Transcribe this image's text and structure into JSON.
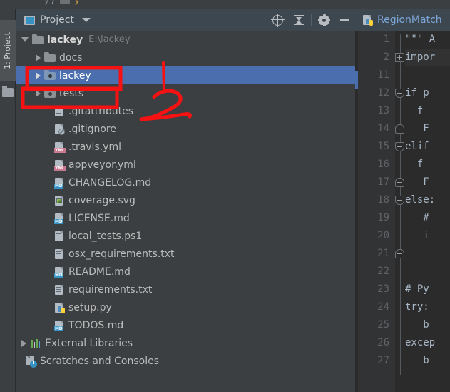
{
  "window": {
    "breadcrumb_partial": "y / ▭ — y",
    "tool_tab_label": "1: Project"
  },
  "panel": {
    "title": "Project",
    "window_icon": "project-window-icon",
    "dropdown_icon": "chevron-down-icon",
    "actions": [
      {
        "name": "locate-in-tree",
        "icon": "target-icon"
      },
      {
        "name": "collapse-all",
        "icon": "collapse-all-icon"
      },
      {
        "name": "settings",
        "icon": "gear-icon"
      },
      {
        "name": "hide-panel",
        "icon": "minimize-icon"
      }
    ]
  },
  "tree": {
    "rows": [
      {
        "label": "lackey",
        "path": "E:\\lackey",
        "indent": 0,
        "arrow": "open",
        "icon": "folder-icon",
        "bold": true,
        "selected": false
      },
      {
        "label": "docs",
        "path": "",
        "indent": 1,
        "arrow": "closed",
        "icon": "folder-icon",
        "bold": false,
        "selected": false
      },
      {
        "label": "lackey",
        "path": "",
        "indent": 1,
        "arrow": "closed",
        "icon": "source-folder-icon",
        "bold": false,
        "selected": true
      },
      {
        "label": "tests",
        "path": "",
        "indent": 1,
        "arrow": "closed",
        "icon": "test-folder-icon",
        "bold": false,
        "selected": false
      },
      {
        "label": ".gitattributes",
        "path": "",
        "indent": 2,
        "arrow": "none",
        "icon": "text-file-icon",
        "bold": false,
        "selected": false
      },
      {
        "label": ".gitignore",
        "path": "",
        "indent": 2,
        "arrow": "none",
        "icon": "ignore-file-icon",
        "bold": false,
        "selected": false
      },
      {
        "label": ".travis.yml",
        "path": "",
        "indent": 2,
        "arrow": "none",
        "icon": "yml-file-icon",
        "bold": false,
        "selected": false
      },
      {
        "label": "appveyor.yml",
        "path": "",
        "indent": 2,
        "arrow": "none",
        "icon": "yml-file-icon",
        "bold": false,
        "selected": false
      },
      {
        "label": "CHANGELOG.md",
        "path": "",
        "indent": 2,
        "arrow": "none",
        "icon": "md-file-icon",
        "bold": false,
        "selected": false
      },
      {
        "label": "coverage.svg",
        "path": "",
        "indent": 2,
        "arrow": "none",
        "icon": "svg-file-icon",
        "bold": false,
        "selected": false
      },
      {
        "label": "LICENSE.md",
        "path": "",
        "indent": 2,
        "arrow": "none",
        "icon": "md-file-icon",
        "bold": false,
        "selected": false
      },
      {
        "label": "local_tests.ps1",
        "path": "",
        "indent": 2,
        "arrow": "none",
        "icon": "text-file-icon",
        "bold": false,
        "selected": false
      },
      {
        "label": "osx_requirements.txt",
        "path": "",
        "indent": 2,
        "arrow": "none",
        "icon": "text-file-icon",
        "bold": false,
        "selected": false
      },
      {
        "label": "README.md",
        "path": "",
        "indent": 2,
        "arrow": "none",
        "icon": "md-file-icon",
        "bold": false,
        "selected": false
      },
      {
        "label": "requirements.txt",
        "path": "",
        "indent": 2,
        "arrow": "none",
        "icon": "text-file-icon",
        "bold": false,
        "selected": false
      },
      {
        "label": "setup.py",
        "path": "",
        "indent": 2,
        "arrow": "none",
        "icon": "python-file-icon",
        "bold": false,
        "selected": false
      },
      {
        "label": "TODOS.md",
        "path": "",
        "indent": 2,
        "arrow": "none",
        "icon": "md-file-icon",
        "bold": false,
        "selected": false
      },
      {
        "label": "External Libraries",
        "path": "",
        "indent": 0,
        "arrow": "closed",
        "icon": "libraries-icon",
        "bold": false,
        "selected": false
      },
      {
        "label": "Scratches and Consoles",
        "path": "",
        "indent": 0,
        "arrow": "none",
        "icon": "scratches-icon",
        "bold": false,
        "selected": false
      }
    ]
  },
  "editor": {
    "tab_label": "RegionMatch",
    "tab_icon": "python-file-icon",
    "lines": [
      {
        "num": "1",
        "fold": "none",
        "text": "\"\"\" A",
        "cls": "c-str"
      },
      {
        "num": "2",
        "fold": "plus",
        "text": "impor",
        "cls": "c-ident"
      },
      {
        "num": "11",
        "fold": "none",
        "text": "",
        "cls": "c-ident"
      },
      {
        "num": "12",
        "fold": "down",
        "text": "if p",
        "cls": "c-kw"
      },
      {
        "num": "13",
        "fold": "none",
        "text": "  f",
        "cls": "c-kw"
      },
      {
        "num": "14",
        "fold": "up",
        "text": "   F",
        "cls": "c-ident"
      },
      {
        "num": "15",
        "fold": "down",
        "text": "elif",
        "cls": "c-kw"
      },
      {
        "num": "16",
        "fold": "none",
        "text": "  f",
        "cls": "c-kw"
      },
      {
        "num": "17",
        "fold": "up",
        "text": "   F",
        "cls": "c-ident"
      },
      {
        "num": "18",
        "fold": "down",
        "text": "else:",
        "cls": "c-kw"
      },
      {
        "num": "19",
        "fold": "none",
        "text": "   #",
        "cls": "c-cmt"
      },
      {
        "num": "20",
        "fold": "none",
        "text": "   i",
        "cls": "c-kw"
      },
      {
        "num": "21",
        "fold": "up",
        "text": "",
        "cls": "c-ident"
      },
      {
        "num": "22",
        "fold": "none",
        "text": "",
        "cls": "c-ident"
      },
      {
        "num": "23",
        "fold": "none",
        "text": "# Py",
        "cls": "c-cmt"
      },
      {
        "num": "24",
        "fold": "none",
        "text": "try:",
        "cls": "c-kw"
      },
      {
        "num": "25",
        "fold": "none",
        "text": "   b",
        "cls": "c-ref"
      },
      {
        "num": "26",
        "fold": "none",
        "text": "excep",
        "cls": "c-kw"
      },
      {
        "num": "27",
        "fold": "none",
        "text": "   b",
        "cls": "c-ref"
      }
    ]
  },
  "annotations": {
    "color": "#f61212",
    "items": [
      {
        "name": "highlight-box-lackey",
        "shape": "rect"
      },
      {
        "name": "highlight-box-tests",
        "shape": "rect"
      },
      {
        "name": "handwritten-marker-2",
        "shape": "digit-2",
        "value": "2"
      },
      {
        "name": "pointer-line",
        "shape": "line"
      }
    ]
  },
  "colors": {
    "panel_bg": "#3c3f41",
    "header_bg": "#3c4750",
    "selection_blue": "#4b6eaf",
    "editor_bg": "#2b2b2b",
    "gutter_bg": "#313335",
    "annotation_red": "#f61212",
    "accent_blue": "#3592c4"
  }
}
